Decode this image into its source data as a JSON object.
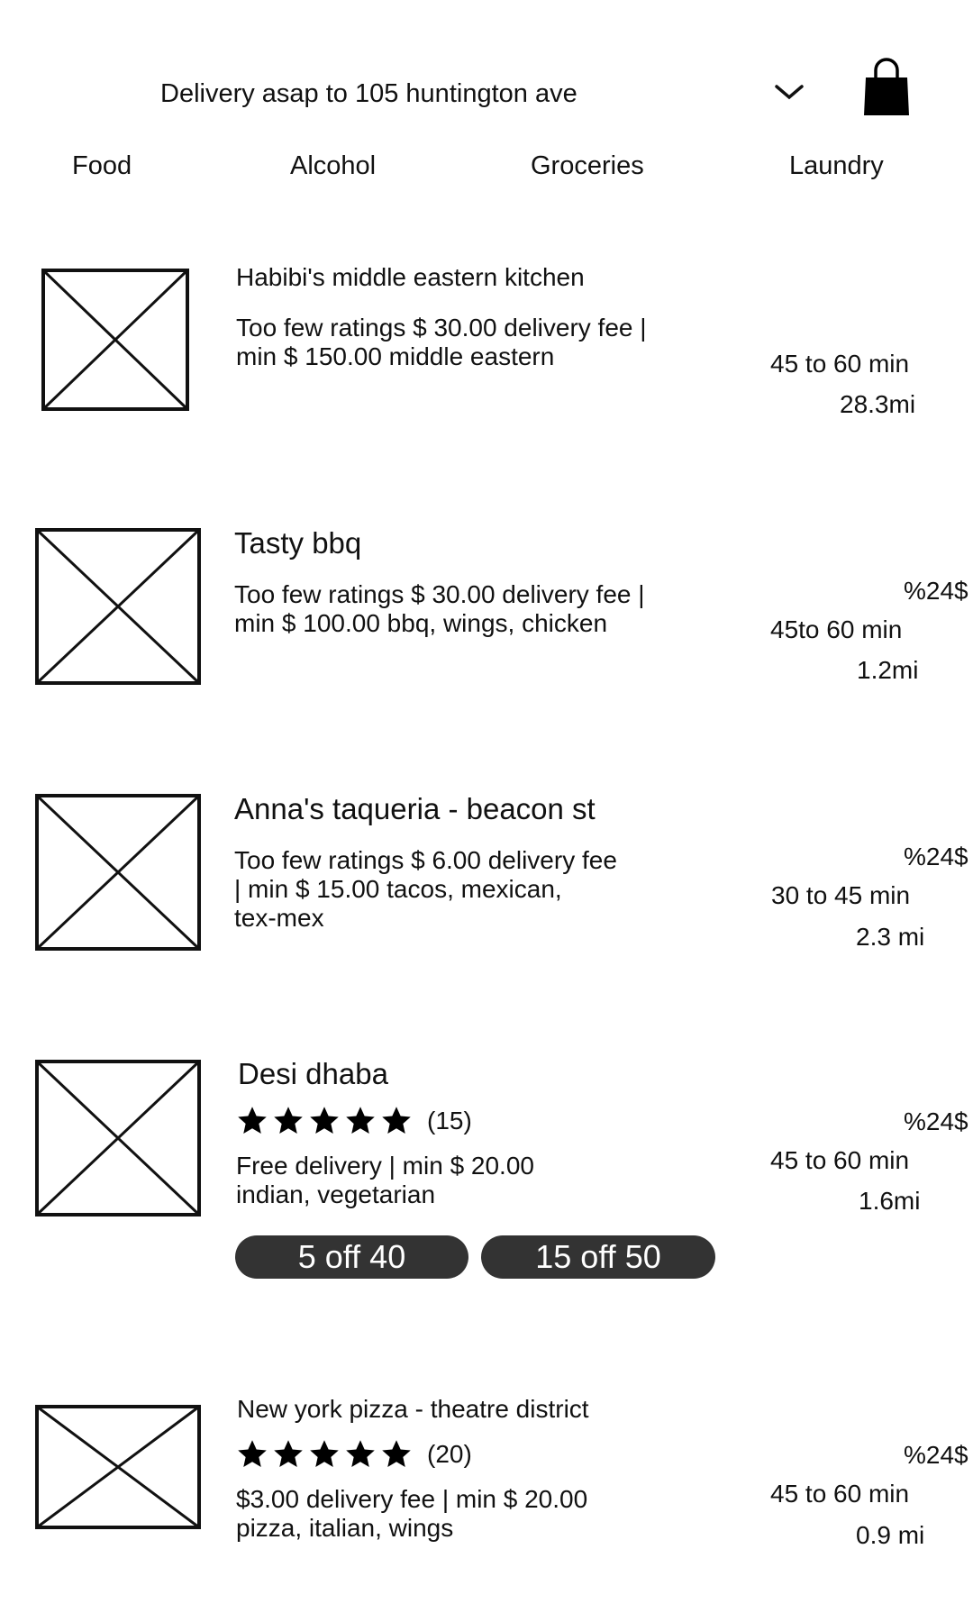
{
  "header": {
    "delivery_text": "Delivery asap to 105 huntington ave",
    "dropdown_icon": "chevron-down-icon",
    "cart_icon": "shopping-bag-icon"
  },
  "tabs": [
    "Food",
    "Alcohol",
    "Groceries",
    "Laundry"
  ],
  "restaurants": [
    {
      "name": "Habibi's middle eastern kitchen",
      "desc_line1": "Too few ratings $ 30.00 delivery fee |",
      "desc_line2": "min $ 150.00 middle eastern",
      "eta": "45 to 60 min",
      "distance": "28.3mi"
    },
    {
      "name": "Tasty bbq",
      "desc_line1": "Too few ratings $ 30.00 delivery fee |",
      "desc_line2": "min $ 100.00 bbq, wings, chicken",
      "price_tag": "%24$",
      "eta": "45to 60 min",
      "distance": "1.2mi"
    },
    {
      "name": "Anna's taqueria - beacon st",
      "desc_line1": "Too few ratings $ 6.00 delivery fee",
      "desc_line2": "| min $ 15.00 tacos, mexican,",
      "desc_line3": "tex-mex",
      "price_tag": "%24$",
      "eta": "30 to 45 min",
      "distance": "2.3 mi"
    },
    {
      "name": "Desi dhaba",
      "rating": 5,
      "rating_count": "(15)",
      "desc_line1": "Free delivery | min $ 20.00",
      "desc_line2": "indian, vegetarian",
      "promos": [
        "5 off 40",
        "15 off 50"
      ],
      "price_tag": "%24$",
      "eta": "45 to 60 min",
      "distance": "1.6mi"
    },
    {
      "name": "New york pizza - theatre district",
      "rating": 5,
      "rating_count": "(20)",
      "desc_line1": "$3.00 delivery fee | min $ 20.00",
      "desc_line2": "pizza, italian, wings",
      "price_tag": "%24$",
      "eta": "45 to 60 min",
      "distance": "0.9 mi"
    }
  ]
}
